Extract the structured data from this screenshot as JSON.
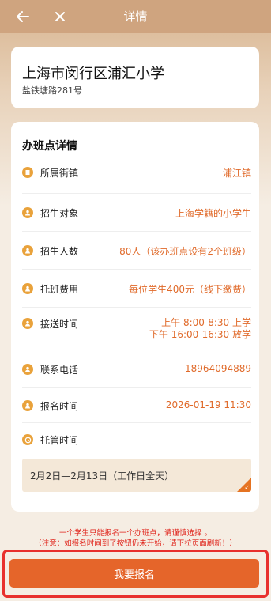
{
  "header": {
    "title": "详情"
  },
  "school": {
    "name": "上海市闵行区浦汇小学",
    "address": "盐铁塘路281号"
  },
  "details": {
    "heading": "办班点详情",
    "rows": [
      {
        "label": "所属街镇",
        "value": "浦江镇"
      },
      {
        "label": "招生对象",
        "value": "上海学籍的小学生"
      },
      {
        "label": "招生人数",
        "value": "80人（该办班点设有2个班级）"
      },
      {
        "label": "托班费用",
        "value": "每位学生400元（线下缴费）"
      },
      {
        "label": "接送时间",
        "value": "上午 8:00-8:30 上学",
        "value2": "下午 16:00-16:30 放学"
      },
      {
        "label": "联系电话",
        "value": "18964094889"
      },
      {
        "label": "报名时间",
        "value": "2026-01-19 11:30"
      },
      {
        "label": "托管时间"
      }
    ],
    "care_period": "2月2日—2月13日（工作日全天）"
  },
  "notice": {
    "line1": "一个学生只能报名一个办班点，请谨慎选择 。",
    "line2": "（注意：如报名时间到了按钮仍未开始，请下拉页面刷新！）"
  },
  "submit_label": "我要报名",
  "colors": {
    "accent": "#e5652a",
    "value_text": "#e06a2a",
    "icon": "#e9a23b",
    "header": "#cfa47f"
  }
}
